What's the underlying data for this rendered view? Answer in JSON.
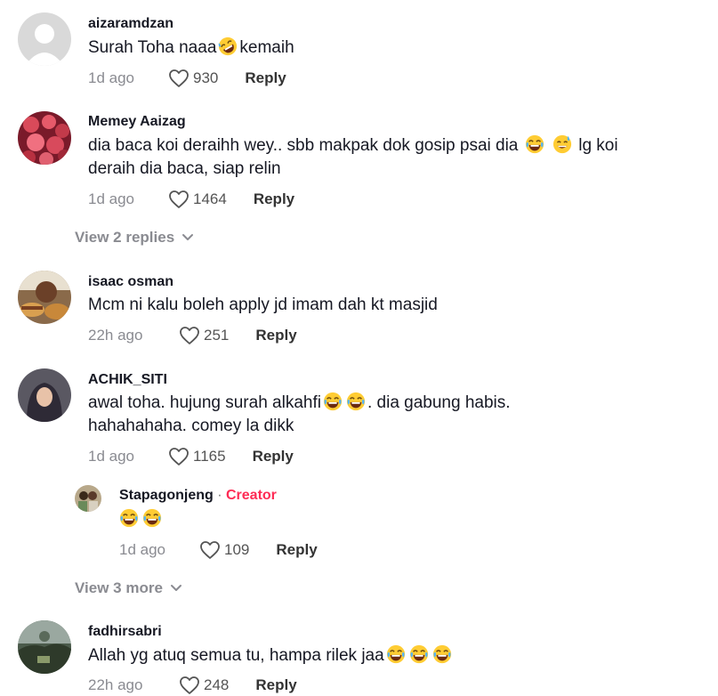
{
  "comments": [
    {
      "username": "aizaramdzan",
      "text_a": "Surah Toha naaa",
      "emoji_mid": "rolling-laugh",
      "text_b": "kemaih",
      "time": "1d ago",
      "likes": "930",
      "reply": "Reply"
    },
    {
      "username": "Memey Aaizag",
      "text_a": "dia baca koi deraihh wey.. sbb makpak dok gosip psai dia",
      "text_b": "lg koi deraih dia baca, siap relin",
      "time": "1d ago",
      "likes": "1464",
      "reply": "Reply",
      "view_replies": "View 2 replies"
    },
    {
      "username": "isaac osman",
      "text": "Mcm ni kalu boleh apply jd imam dah kt masjid",
      "time": "22h ago",
      "likes": "251",
      "reply": "Reply"
    },
    {
      "username": "ACHIK_SITI",
      "text_a": "awal toha. hujung surah alkahfi",
      "text_b": ". dia gabung habis.",
      "text_c": "hahahahaha. comey la dikk",
      "time": "1d ago",
      "likes": "1165",
      "reply": "Reply"
    },
    {
      "username": "fadhirsabri",
      "text": "Allah yg atuq semua tu, hampa rilek jaa",
      "time": "22h ago",
      "likes": "248",
      "reply": "Reply"
    }
  ],
  "creator_reply": {
    "username": "Stapagonjeng",
    "separator": " · ",
    "creator_label": "Creator",
    "time": "1d ago",
    "likes": "109",
    "reply": "Reply"
  },
  "view_more": "View 3 more",
  "colors": {
    "creator": "#fe2c55",
    "meta": "#8a8b91",
    "text": "#161823"
  }
}
